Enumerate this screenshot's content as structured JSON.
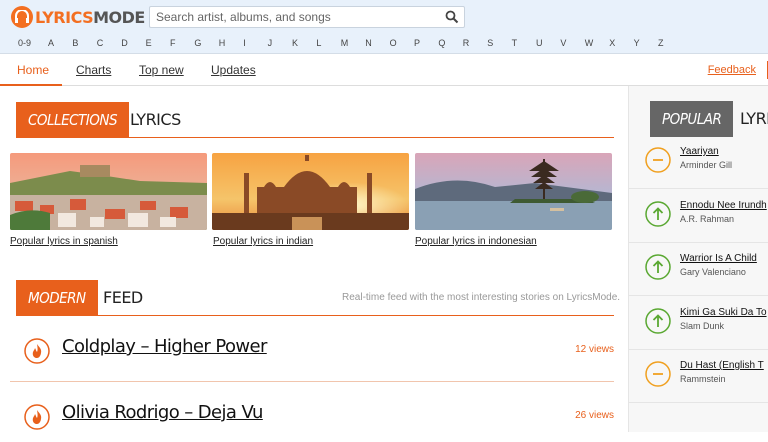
{
  "header": {
    "logo_part1": "LYRICS",
    "logo_part2": "MODE",
    "search_placeholder": "Search artist, albums, and songs"
  },
  "alphabet": [
    "0-9",
    "A",
    "B",
    "C",
    "D",
    "E",
    "F",
    "G",
    "H",
    "I",
    "J",
    "K",
    "L",
    "M",
    "N",
    "O",
    "P",
    "Q",
    "R",
    "S",
    "T",
    "U",
    "V",
    "W",
    "X",
    "Y",
    "Z"
  ],
  "nav": {
    "items": [
      "Home",
      "Charts",
      "Top new",
      "Updates"
    ],
    "active": "Home",
    "feedback": "Feedback"
  },
  "collections": {
    "tag": "COLLECTIONS",
    "label": "LYRICS",
    "cards": [
      {
        "label": "Popular lyrics in spanish"
      },
      {
        "label": "Popular lyrics in indian"
      },
      {
        "label": "Popular lyrics in indonesian"
      }
    ]
  },
  "feed": {
    "tag": "MODERN",
    "label": "FEED",
    "subtitle": "Real-time feed with the most interesting stories on LyricsMode.",
    "items": [
      {
        "title": "Coldplay – Higher Power",
        "views": "12 views"
      },
      {
        "title": "Olivia Rodrigo – Deja Vu",
        "views": "26 views"
      }
    ]
  },
  "popular": {
    "tag": "POPULAR",
    "label": "LYRI",
    "items": [
      {
        "song": "Yaariyan",
        "artist": "Arminder Gill",
        "trend": "same"
      },
      {
        "song": "Ennodu Nee Irundh",
        "artist": "A.R. Rahman",
        "trend": "up"
      },
      {
        "song": "Warrior Is A Child",
        "artist": "Gary Valenciano",
        "trend": "up"
      },
      {
        "song": "Kimi Ga Suki Da To",
        "artist": "Slam Dunk",
        "trend": "up"
      },
      {
        "song": "Du Hast (English T",
        "artist": "Rammstein",
        "trend": "same"
      }
    ]
  },
  "colors": {
    "accent": "#e8601c",
    "up": "#5aa832",
    "same": "#f0a020"
  }
}
